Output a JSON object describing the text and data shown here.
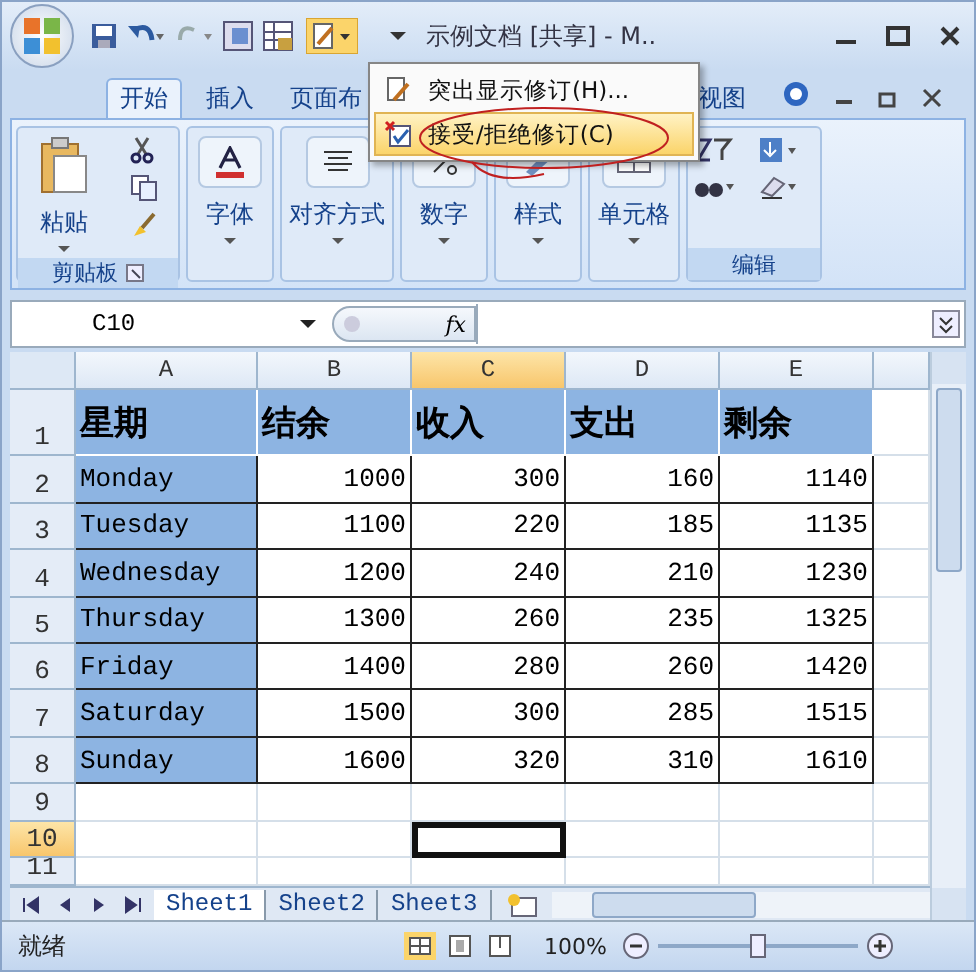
{
  "window": {
    "title": "示例文档  [共享] - M.."
  },
  "ribbon_tabs": [
    {
      "label": "开始",
      "selected": true
    },
    {
      "label": "插入",
      "selected": false
    },
    {
      "label": "页面布",
      "selected": false
    },
    {
      "label": "视图",
      "selected": false
    }
  ],
  "ribbon_groups": [
    {
      "kind": "clipboard",
      "label": "剪贴板",
      "buttons": [
        "粘贴"
      ]
    },
    {
      "kind": "font",
      "buttons": [
        "字体"
      ]
    },
    {
      "kind": "align",
      "buttons": [
        "对齐方式"
      ]
    },
    {
      "kind": "number",
      "buttons": [
        "数字"
      ]
    },
    {
      "kind": "style",
      "buttons": [
        "样式"
      ]
    },
    {
      "kind": "cells",
      "buttons": [
        "单元格"
      ]
    },
    {
      "kind": "edit",
      "label": "编辑"
    }
  ],
  "menu": {
    "items": [
      {
        "label": "突出显示修订(H)...",
        "selected": false
      },
      {
        "label": "接受/拒绝修订(C)",
        "selected": true
      }
    ]
  },
  "formula_bar": {
    "name_box": "C10",
    "fx": "fx"
  },
  "sheet": {
    "columns": [
      {
        "label": "A",
        "selected": false
      },
      {
        "label": "B",
        "selected": false
      },
      {
        "label": "C",
        "selected": true
      },
      {
        "label": "D",
        "selected": false
      },
      {
        "label": "E",
        "selected": false
      }
    ],
    "rows": [
      {
        "number": "1",
        "selected": false,
        "cells": [
          "星期",
          "结余",
          "收入",
          "支出",
          "剩余"
        ]
      },
      {
        "number": "2",
        "selected": false,
        "cells": [
          "Monday",
          "1000",
          "300",
          "160",
          "1140"
        ]
      },
      {
        "number": "3",
        "selected": false,
        "cells": [
          "Tuesday",
          "1100",
          "220",
          "185",
          "1135"
        ]
      },
      {
        "number": "4",
        "selected": false,
        "cells": [
          "Wednesday",
          "1200",
          "240",
          "210",
          "1230"
        ]
      },
      {
        "number": "5",
        "selected": false,
        "cells": [
          "Thursday",
          "1300",
          "260",
          "235",
          "1325"
        ]
      },
      {
        "number": "6",
        "selected": false,
        "cells": [
          "Friday",
          "1400",
          "280",
          "260",
          "1420"
        ]
      },
      {
        "number": "7",
        "selected": false,
        "cells": [
          "Saturday",
          "1500",
          "300",
          "285",
          "1515"
        ]
      },
      {
        "number": "8",
        "selected": false,
        "cells": [
          "Sunday",
          "1600",
          "320",
          "310",
          "1610"
        ]
      },
      {
        "number": "9",
        "selected": false,
        "cells": []
      },
      {
        "number": "10",
        "selected": true,
        "cells": []
      },
      {
        "number": "11",
        "selected": false,
        "cells": []
      }
    ]
  },
  "sheet_tabs": [
    {
      "label": "Sheet1",
      "selected": true
    },
    {
      "label": "Sheet2",
      "selected": false
    },
    {
      "label": "Sheet3",
      "selected": false
    }
  ],
  "status_bar": {
    "status": "就绪",
    "zoom": "100%",
    "zoom_slider": {
      "level": 0.5
    }
  }
}
